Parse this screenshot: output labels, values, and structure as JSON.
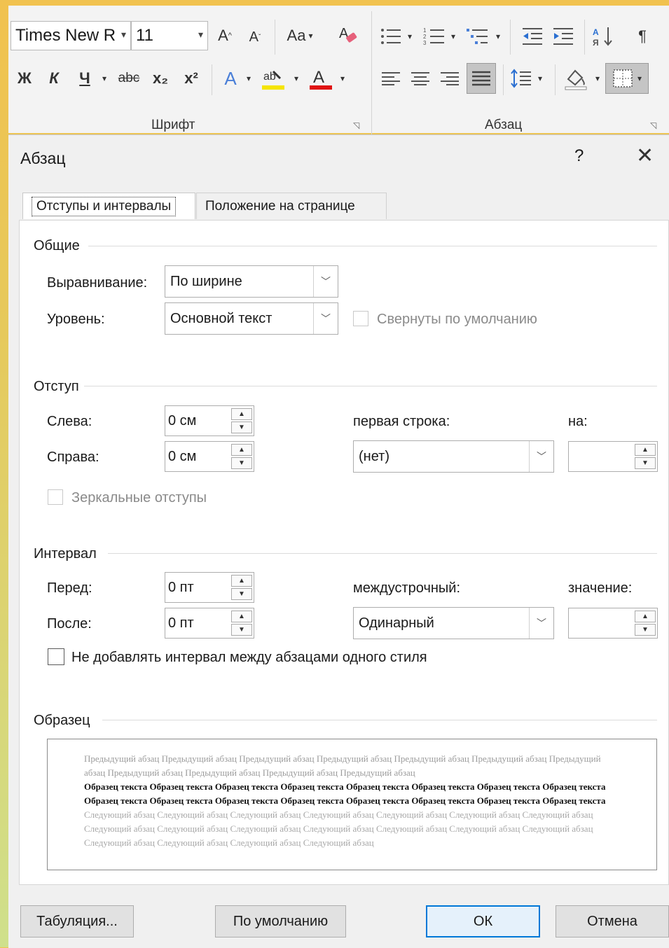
{
  "ribbon": {
    "font_name": "Times New R",
    "font_size": "11",
    "change_case": "Aa",
    "bold": "Ж",
    "italic": "К",
    "underline": "Ч",
    "strike": "abc",
    "subscript": "x₂",
    "superscript": "x²",
    "font_group": "Шрифт",
    "paragraph_group": "Абзац",
    "pilcrow": "¶"
  },
  "dialog": {
    "title": "Абзац",
    "help": "?",
    "close": "✕",
    "tabs": [
      "Отступы и интервалы",
      "Положение на странице"
    ],
    "general": {
      "section": "Общие",
      "alignment_label": "Выравнивание:",
      "alignment_value": "По ширине",
      "level_label": "Уровень:",
      "level_value": "Основной текст",
      "collapsed_label": "Свернуты по умолчанию"
    },
    "indent": {
      "section": "Отступ",
      "left_label": "Слева:",
      "left_value": "0 см",
      "right_label": "Справа:",
      "right_value": "0 см",
      "first_line_label": "первая строка:",
      "first_line_value": "(нет)",
      "by_label": "на:",
      "by_value": "",
      "mirror_label": "Зеркальные отступы"
    },
    "spacing": {
      "section": "Интервал",
      "before_label": "Перед:",
      "before_value": "0 пт",
      "after_label": "После:",
      "after_value": "0 пт",
      "line_label": "междустрочный:",
      "line_value": "Одинарный",
      "at_label": "значение:",
      "at_value": "",
      "no_space_label": "Не добавлять интервал между абзацами одного стиля"
    },
    "preview": {
      "section": "Образец",
      "prev_text": "Предыдущий абзац Предыдущий абзац Предыдущий абзац Предыдущий абзац Предыдущий абзац Предыдущий абзац Предыдущий абзац Предыдущий абзац Предыдущий абзац Предыдущий абзац Предыдущий абзац",
      "sample_text": "Образец текста Образец текста Образец текста Образец текста Образец текста Образец текста Образец текста Образец текста Образец текста Образец текста Образец текста Образец текста Образец текста Образец текста Образец текста Образец текста",
      "next_text": "Следующий абзац Следующий абзац Следующий абзац Следующий абзац Следующий абзац Следующий абзац Следующий абзац Следующий абзац Следующий абзац Следующий абзац Следующий абзац Следующий абзац Следующий абзац Следующий абзац Следующий абзац Следующий абзац Следующий абзац Следующий абзац"
    },
    "buttons": {
      "tabs": "Табуляция...",
      "default": "По умолчанию",
      "ok": "ОК",
      "cancel": "Отмена"
    }
  }
}
